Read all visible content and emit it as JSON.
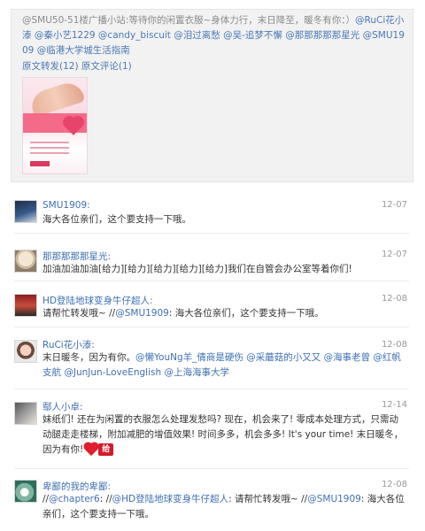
{
  "original": {
    "line1": "@SMU50-51楼广播小站:等待你的闲置衣服~身体力行，末日降至，暖冬有你：）",
    "mentions": [
      "@RuCi花小溙",
      "@秦小艺1229",
      "@candy_biscuit",
      "@泪过离愁",
      "@吴-追梦不懈",
      "@那那那那那星光",
      "@SMU1909",
      "@临港大学城生活指南"
    ],
    "forward_link": "原文转发(12)",
    "comment_link": "原文评论(1)"
  },
  "comments": [
    {
      "name": "SMU1909:",
      "date": "12-07",
      "text": "海大各位亲们，这个要支持一下哦。"
    },
    {
      "name": "那那那那那星光:",
      "date": "12-07",
      "text": "加油加油加油[给力][给力][给力][给力][给力]我们在自管会办公室等着你们!"
    },
    {
      "name": "HD登陆地球变身牛仔超人:",
      "date": "12-08",
      "text_prefix": "请帮忙转发哦~ //",
      "mention": "@SMU1909",
      "text_suffix": ": 海大各位亲们，这个要支持一下哦。"
    },
    {
      "name": "RuCi花小溙:",
      "date": "12-08",
      "text_prefix": "末日暖冬，因为有你。",
      "mentions": [
        "@懒YouNg羊_倩商是硬伤",
        "@采蘑菇的小又又",
        "@海事老曾",
        "@红帆支航",
        "@JunJun-LoveEnglish",
        "@上海海事大学"
      ]
    },
    {
      "name": "鄢人小卓:",
      "date": "12-14",
      "text": "妹纸们! 还在为闲置的衣服怎么处理发愁吗? 现在，机会来了! 零成本处理方式，只需动动腿走走楼梯，附加减肥的增值效果! 时间多多，机会多多! It's your time! 末日暖冬，因为有你!",
      "emoticon_text": "给"
    },
    {
      "name": "卑鄙的我的卑鄙:",
      "date": "12-08",
      "mention1": "@chapter6",
      "mention2": "@HD登陆地球变身牛仔超人",
      "middle": ": 请帮忙转发哦~ //",
      "mention3": "@SMU1909",
      "tail": ": 海大各位亲们，这个要支持一下哦。"
    }
  ]
}
